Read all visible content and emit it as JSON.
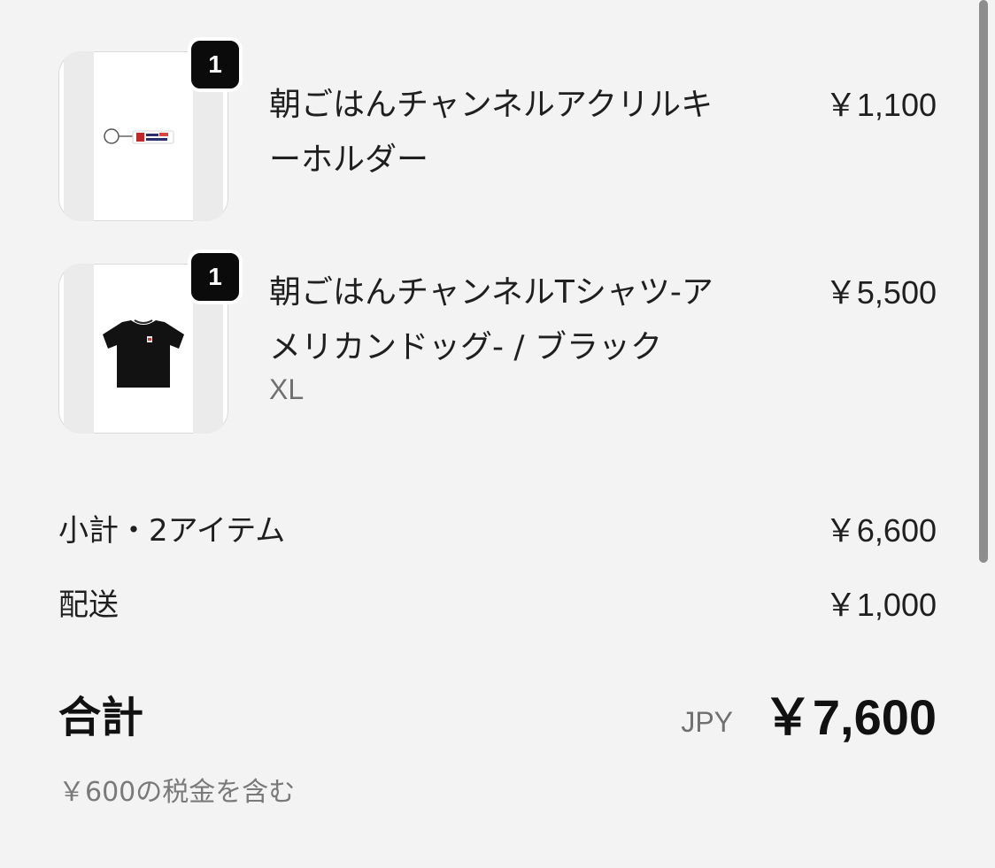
{
  "cart": {
    "items": [
      {
        "quantity": "1",
        "name_line1": "朝ごはんチャンネルアクリルキ",
        "name_line2": "ーホルダー",
        "variant": "",
        "price": "￥1,100",
        "image_icon": "acrylic-keychain-image"
      },
      {
        "quantity": "1",
        "name_line1": "朝ごはんチャンネルTシャツ-ア",
        "name_line2": "メリカンドッグ- / ブラック",
        "variant": "XL",
        "price": "￥5,500",
        "image_icon": "black-tshirt-image"
      }
    ]
  },
  "summary": {
    "subtotal_label": "小計・2アイテム",
    "subtotal_value": "￥6,600",
    "shipping_label": "配送",
    "shipping_value": "￥1,000",
    "total_label": "合計",
    "total_currency": "JPY",
    "total_value": "￥7,600",
    "tax_note": "￥600の税金を含む"
  },
  "colors": {
    "background": "#f3f3f3",
    "badge": "#0b0b0b",
    "muted_text": "#707070"
  }
}
